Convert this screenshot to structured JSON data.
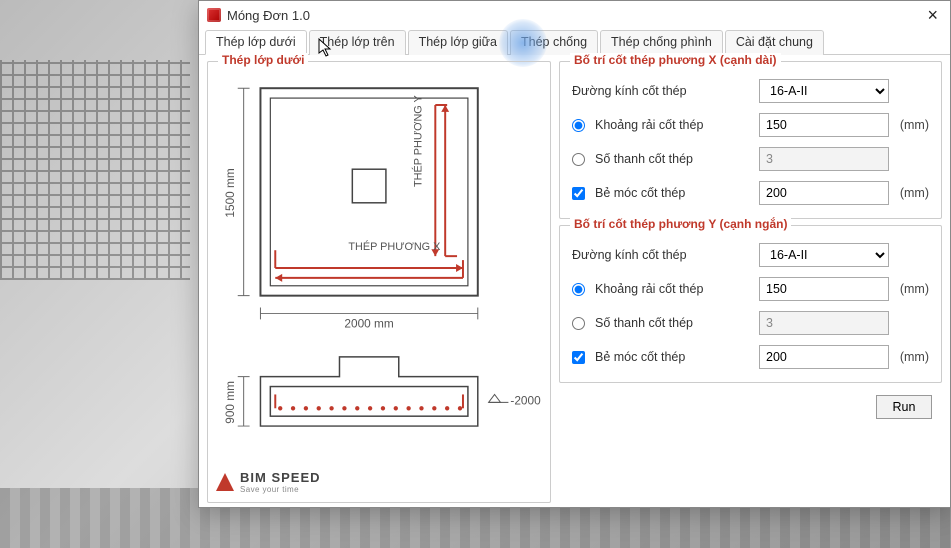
{
  "window": {
    "title": "Móng Đơn 1.0"
  },
  "tabs": {
    "t1": "Thép lớp dưới",
    "t2": "Thép lớp trên",
    "t3": "Thép lớp giữa",
    "t4": "Thép chống",
    "t5": "Thép chống phình",
    "t6": "Cài đặt chung",
    "active": "t1"
  },
  "left_panel": {
    "legend": "Thép lớp dưới",
    "dim_v": "1500 mm",
    "dim_h": "2000 mm",
    "axis_x": "THÉP PHƯƠNG X",
    "axis_y": "THÉP PHƯƠNG Y",
    "sect_v": "900 mm",
    "elev": "-2000 mm"
  },
  "brand": {
    "name": "BIM SPEED",
    "tag": "Save your time"
  },
  "groupX": {
    "legend": "Bố trí cốt thép phương X (cạnh dài)",
    "diameter_label": "Đường kính cốt thép",
    "diameter_value": "16-A-II",
    "spacing_label": "Khoảng rải cốt thép",
    "spacing_value": "150",
    "count_label": "Số thanh cốt thép",
    "count_value": "3",
    "hook_label": "Bẻ móc cốt thép",
    "hook_value": "200",
    "unit_mm": "(mm)"
  },
  "groupY": {
    "legend": "Bố trí cốt thép phương Y (cạnh ngắn)",
    "diameter_label": "Đường kính cốt thép",
    "diameter_value": "16-A-II",
    "spacing_label": "Khoảng rải cốt thép",
    "spacing_value": "150",
    "count_label": "Số thanh cốt thép",
    "count_value": "3",
    "hook_label": "Bẻ móc cốt thép",
    "hook_value": "200",
    "unit_mm": "(mm)"
  },
  "buttons": {
    "run": "Run"
  }
}
